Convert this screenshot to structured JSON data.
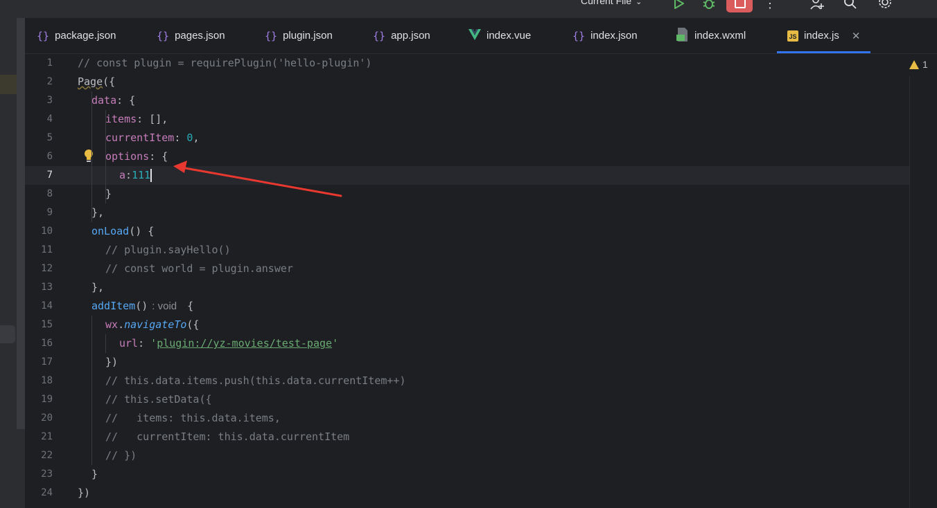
{
  "toolbar": {
    "run_config_label": "Current File",
    "colors": {
      "run": "#5fb865",
      "debug": "#5fb865",
      "stop": "#db5c5c"
    }
  },
  "tabs": [
    {
      "label": "package.json",
      "icon": "json-braces-icon"
    },
    {
      "label": "pages.json",
      "icon": "json-braces-icon"
    },
    {
      "label": "plugin.json",
      "icon": "json-braces-icon"
    },
    {
      "label": "app.json",
      "icon": "json-braces-icon"
    },
    {
      "label": "index.vue",
      "icon": "vue-icon"
    },
    {
      "label": "index.json",
      "icon": "json-braces-icon"
    },
    {
      "label": "index.wxml",
      "icon": "wxml-file-icon"
    },
    {
      "label": "index.js",
      "icon": "js-file-icon",
      "active": true
    }
  ],
  "editor": {
    "line_numbers": [
      "1",
      "2",
      "3",
      "4",
      "5",
      "6",
      "7",
      "8",
      "9",
      "10",
      "11",
      "12",
      "13",
      "14",
      "15",
      "16",
      "17",
      "18",
      "19",
      "20",
      "21",
      "22",
      "23",
      "24"
    ],
    "current_line": 7,
    "inlay_hint": ": void",
    "warnings_count": "1",
    "lines": {
      "l1": "// const plugin = requirePlugin('hello-plugin')",
      "l2_fn": "Page",
      "l2_rest": "({",
      "l3_key": "data",
      "l3_rest": ": {",
      "l4_key": "items",
      "l4_rest": ": [],",
      "l5_key": "currentItem",
      "l5_sep": ": ",
      "l5_num": "0",
      "l5_end": ",",
      "l6_key": "options",
      "l6_rest": ": {",
      "l7_key": "a",
      "l7_sep": ":",
      "l7_num": "111",
      "l8": "}",
      "l9": "},",
      "l10_fn": "onLoad",
      "l10_rest": "() {",
      "l11": "// plugin.sayHello()",
      "l12": "// const world = plugin.answer",
      "l13": "},",
      "l14_fn": "addItem",
      "l14_paren": "()",
      "l14_end": " {",
      "l15_obj": "wx",
      "l15_dot": ".",
      "l15_fn": "navigateTo",
      "l15_rest": "({",
      "l16_key": "url",
      "l16_sep": ": ",
      "l16_q1": "'",
      "l16_url": "plugin://yz-movies/test-page",
      "l16_q2": "'",
      "l17": "})",
      "l18": "// this.data.items.push(this.data.currentItem++)",
      "l19": "// this.setData({",
      "l20": "//   items: this.data.items,",
      "l21": "//   currentItem: this.data.currentItem",
      "l22": "// })",
      "l23": "}",
      "l24": "})"
    }
  }
}
